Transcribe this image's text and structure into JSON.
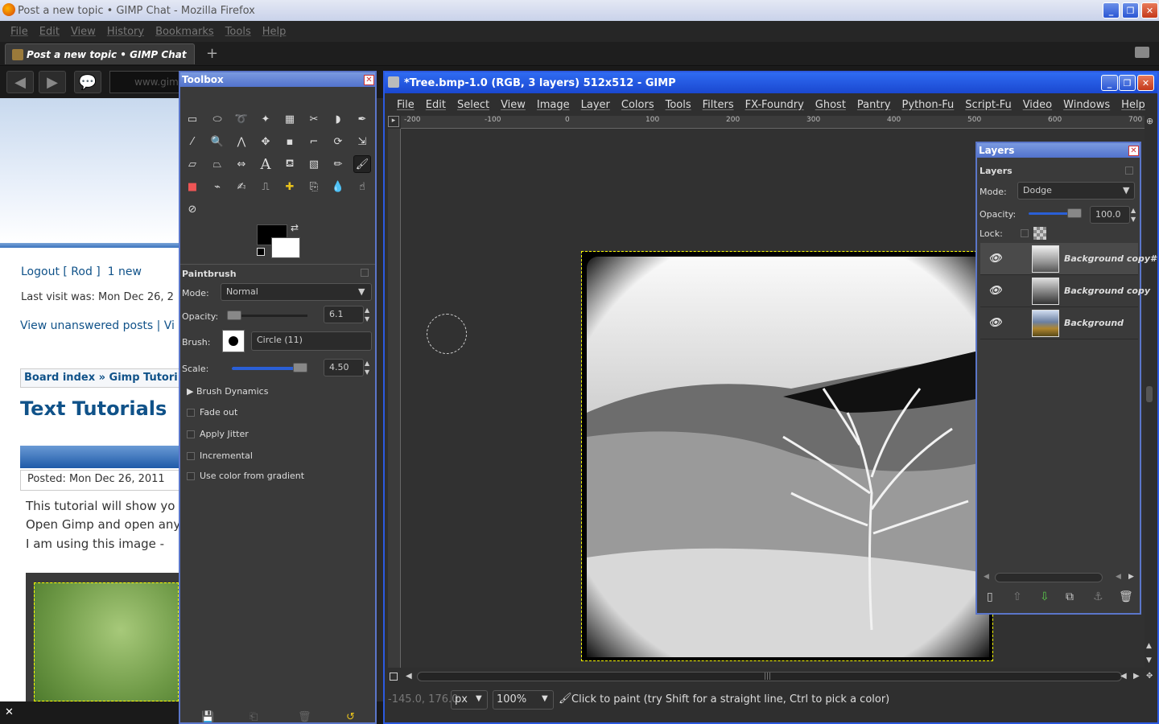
{
  "firefox": {
    "window_title": "Post a new topic • GIMP Chat - Mozilla Firefox",
    "menu": [
      "File",
      "Edit",
      "View",
      "History",
      "Bookmarks",
      "Tools",
      "Help"
    ],
    "tab_label": "Post a new topic • GIMP Chat",
    "url_partial": "www.gim"
  },
  "webpage": {
    "logout": "Logout [ Rod ]",
    "new_msgs": "1 new",
    "last_visit": "Last visit was: Mon Dec 26, 2",
    "view_unanswered": "View unanswered posts | Vi",
    "breadcrumb": "Board index » Gimp Tutori",
    "title": "Text Tutorials",
    "posted": "Posted: Mon Dec 26, 2011",
    "body_lines": [
      "This tutorial will show yo",
      "Open Gimp and open any",
      "I am using this image -"
    ]
  },
  "toolbox": {
    "title": "Toolbox",
    "tool_options_title": "Paintbrush",
    "mode_label": "Mode:",
    "mode_value": "Normal",
    "opacity_label": "Opacity:",
    "opacity_value": "6.1",
    "opacity_level": 0.061,
    "brush_label": "Brush:",
    "brush_value": "Circle (11)",
    "scale_label": "Scale:",
    "scale_value": "4.50",
    "brush_dynamics": "Brush Dynamics",
    "checkboxes": [
      "Fade out",
      "Apply Jitter",
      "Incremental",
      "Use color from gradient"
    ]
  },
  "gimp": {
    "window_title": "*Tree.bmp-1.0 (RGB, 3 layers) 512x512 - GIMP",
    "menu": [
      "File",
      "Edit",
      "Select",
      "View",
      "Image",
      "Layer",
      "Colors",
      "Tools",
      "Filters",
      "FX-Foundry",
      "Ghost",
      "Pantry",
      "Python-Fu",
      "Script-Fu",
      "Video",
      "Windows",
      "Help"
    ],
    "ruler_ticks": [
      "-200",
      "-100",
      "0",
      "100",
      "200",
      "300",
      "400",
      "500",
      "600",
      "700"
    ],
    "coords": "-145.0, 176.0",
    "unit": "px",
    "zoom": "100%",
    "status_message": "Click to paint (try Shift for a straight line, Ctrl to pick a color)"
  },
  "layers": {
    "title": "Layers",
    "subtitle": "Layers",
    "mode_label": "Mode:",
    "mode_value": "Dodge",
    "opacity_label": "Opacity:",
    "opacity_value": "100.0",
    "lock_label": "Lock:",
    "items": [
      {
        "name": "Background copy#"
      },
      {
        "name": "Background copy"
      },
      {
        "name": "Background"
      }
    ]
  },
  "colors": {
    "accent": "#2c5ae0",
    "panel_bg": "#3a3a3a",
    "link": "#105289"
  }
}
